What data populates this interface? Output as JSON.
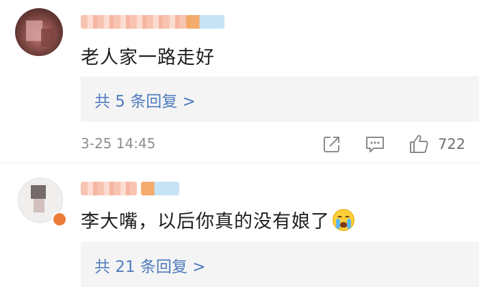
{
  "comments": [
    {
      "text": "老人家一路走好",
      "replies_label": "共 5 条回复 >",
      "timestamp": "3-25 14:45",
      "likes": "722"
    },
    {
      "text": "李大嘴，以后你真的没有娘了",
      "replies_label": "共 21 条回复 >"
    }
  ],
  "icons": {
    "share": "share-icon",
    "comment": "comment-icon",
    "like": "thumbs-up-icon",
    "emoji": "crying-face-emoji"
  },
  "colors": {
    "link": "#4f7bbd",
    "meta": "#8e8e8e",
    "text": "#1e1e1e",
    "reply_bg": "#f4f4f4"
  }
}
